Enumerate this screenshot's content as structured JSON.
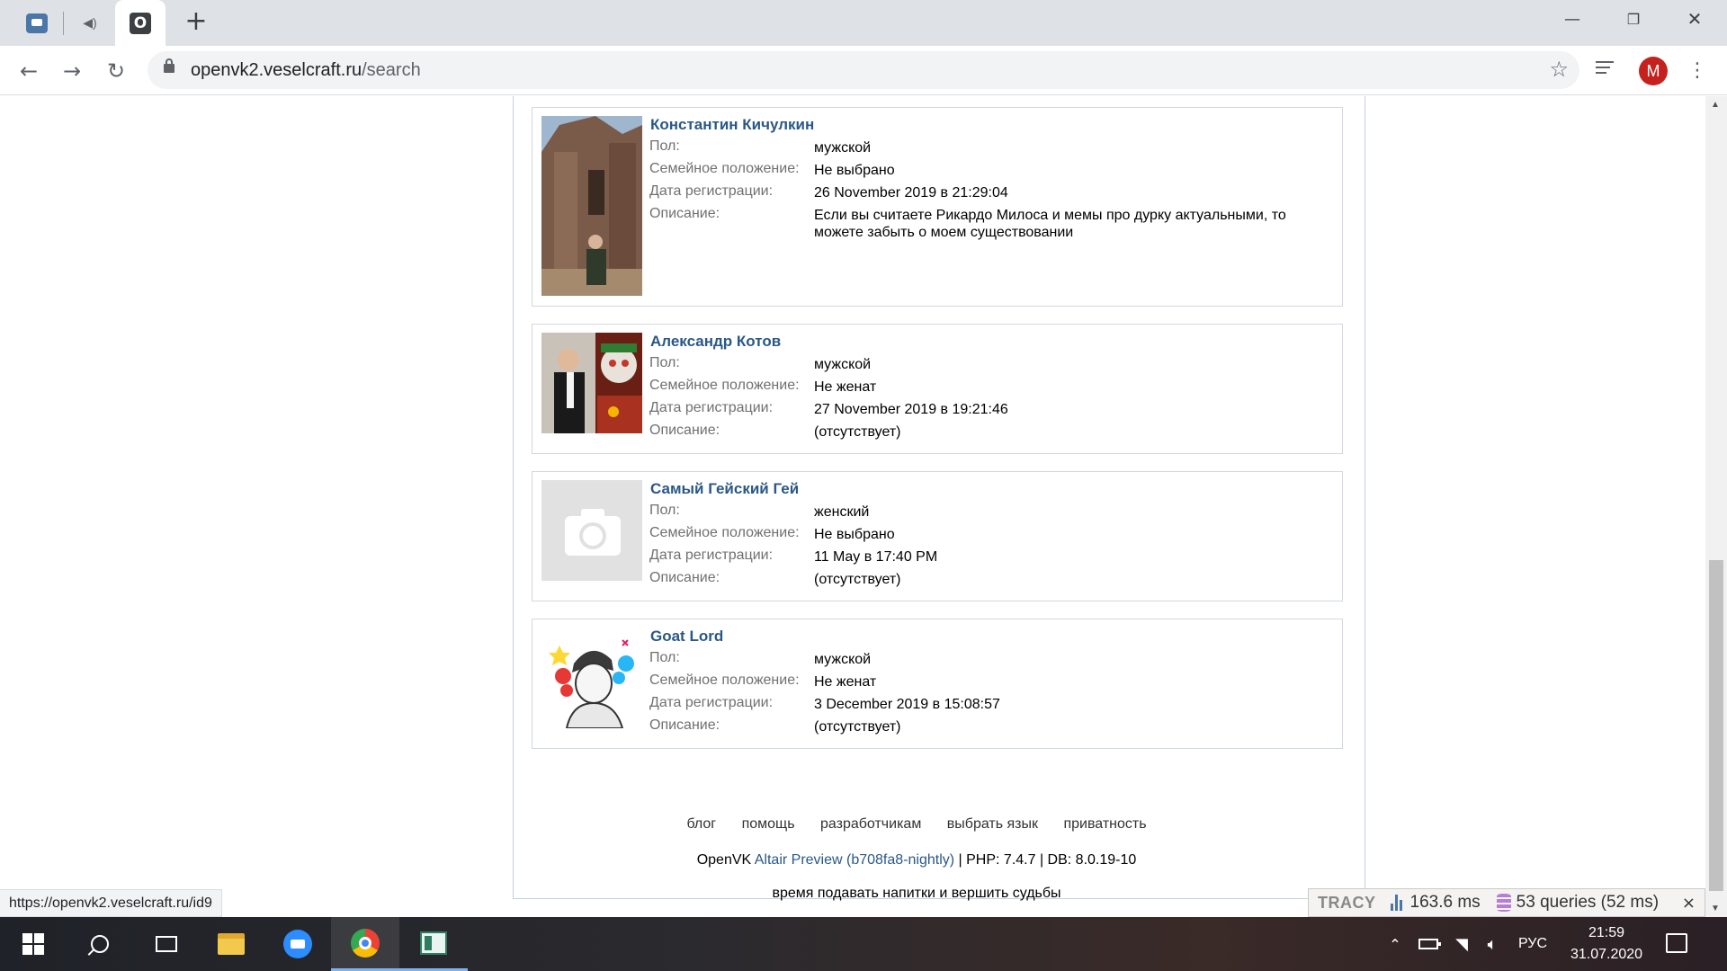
{
  "browser": {
    "url_host": "openvk2.veselcraft.ru",
    "url_path": "/search",
    "profile_initial": "M",
    "status_url": "https://openvk2.veselcraft.ru/id9"
  },
  "labels": {
    "gender": "Пол:",
    "marital": "Семейное положение:",
    "registered": "Дата регистрации:",
    "description": "Описание:"
  },
  "results": [
    {
      "name": "Константин Кичулкин",
      "gender": "мужской",
      "marital": "Не выбрано",
      "registered": "26 November 2019 в 21:29:04",
      "description": "Если вы считаете Рикардо Милоса и мемы про дурку актуальными, то можете забыть о моем существовании"
    },
    {
      "name": "Александр Котов",
      "gender": "мужской",
      "marital": "Не женат",
      "registered": "27 November 2019 в 19:21:46",
      "description": "(отсутствует)"
    },
    {
      "name": "Самый Гейский Гей",
      "gender": "женский",
      "marital": "Не выбрано",
      "registered": "11 May в 17:40 PM",
      "description": "(отсутствует)"
    },
    {
      "name": "Goat Lord",
      "gender": "мужской",
      "marital": "Не женат",
      "registered": "3 December 2019 в 15:08:57",
      "description": "(отсутствует)"
    }
  ],
  "footer": {
    "links": [
      "блог",
      "помощь",
      "разработчикам",
      "выбрать язык",
      "приватность"
    ],
    "version_prefix": "OpenVK ",
    "version_link": "Altair Preview (b708fa8-nightly)",
    "version_suffix": " | PHP: 7.4.7 | DB: 8.0.19-10",
    "motto": "время подавать напитки и вершить судьбы"
  },
  "tracy": {
    "logo": "TRACY",
    "time": "163.6 ms",
    "queries": "53 queries (52 ms)",
    "close": "×"
  },
  "taskbar": {
    "lang": "РУС",
    "time": "21:59",
    "date": "31.07.2020"
  }
}
